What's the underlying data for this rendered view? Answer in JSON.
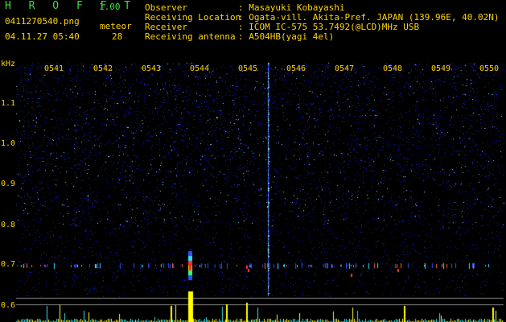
{
  "app": {
    "title": "H R O F F T",
    "version": "1.00"
  },
  "file_name": "0411270540.png",
  "datetime": "04.11.27 05:40",
  "meteor": {
    "label": "meteor",
    "count": "28"
  },
  "info": [
    {
      "label": "Observer",
      "value": ": Masayuki Kobayashi"
    },
    {
      "label": "Receiving Location",
      "value": ": Ogata-vill. Akita-Pref. JAPAN (139.96E, 40.02N)"
    },
    {
      "label": "Receiver",
      "value": ": ICOM IC-575 53.7492(@LCD)MHz USB"
    },
    {
      "label": "Receiving antenna",
      "value": ": A504HB(yagi 4el)"
    }
  ],
  "spectrogram": {
    "y_unit": "kHz",
    "time_ticks": [
      "0541",
      "0542",
      "0543",
      "0544",
      "0545",
      "0546",
      "0547",
      "0548",
      "0549",
      "0550"
    ],
    "freq_ticks": [
      "1.1",
      "1.0",
      "0.9",
      "0.8",
      "0.7",
      "0.6"
    ],
    "colors": {
      "background": "#000000",
      "noise": "#1c28d8",
      "text": "#ffd400",
      "accent_green": "#3fdc3f",
      "meteor_trace": "#ff4a3a",
      "echo_bar": "#ffff00"
    }
  }
}
